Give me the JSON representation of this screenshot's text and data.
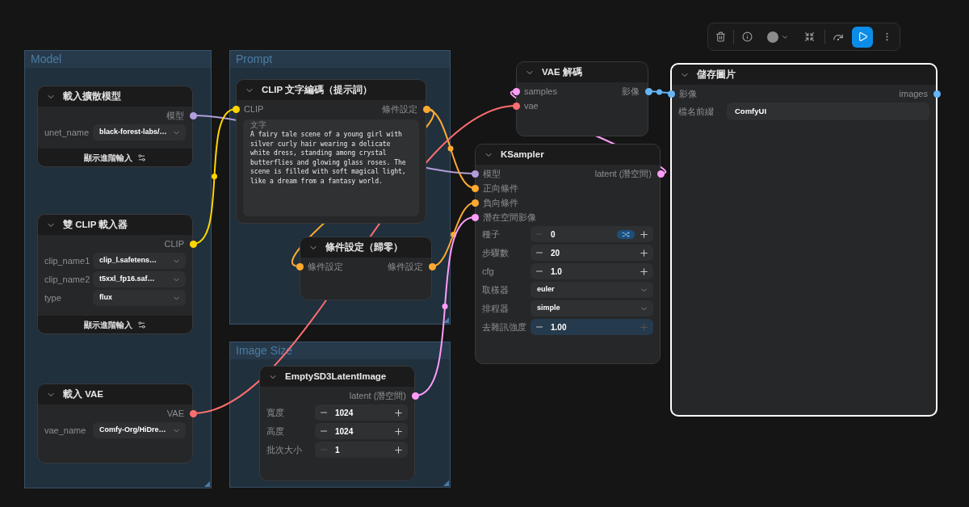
{
  "groups": [
    {
      "title": "Model"
    },
    {
      "title": "Prompt"
    },
    {
      "title": "Image Size"
    }
  ],
  "nodes": [
    {
      "title": "載入擴散模型",
      "selected": false,
      "outputs": [
        {
          "label": "模型",
          "color": "#b39ddb"
        }
      ],
      "widgets": [
        {
          "kind": "combo",
          "label": "unet_name",
          "value": "black-forest-labs/…",
          "hovered": false
        }
      ],
      "advanced_toggle": "顯示進階輸入"
    },
    {
      "title": "雙 CLIP 載入器",
      "selected": false,
      "outputs": [
        {
          "label": "CLIP",
          "color": "#ffd500"
        }
      ],
      "widgets": [
        {
          "kind": "combo",
          "label": "clip_name1",
          "value": "clip_l.safetens…",
          "hovered": false
        },
        {
          "kind": "combo",
          "label": "clip_name2",
          "value": "t5xxl_fp16.saf…",
          "hovered": false
        },
        {
          "kind": "combo",
          "label": "type",
          "value": "flux",
          "hovered": false
        }
      ],
      "advanced_toggle": "顯示進階輸入"
    },
    {
      "title": "載入 VAE",
      "selected": false,
      "outputs": [
        {
          "label": "VAE",
          "color": "#ff6e6e"
        }
      ],
      "widgets": [
        {
          "kind": "combo",
          "label": "vae_name",
          "value": "Comfy-Org/HiDre…",
          "hovered": false
        }
      ]
    },
    {
      "title": "CLIP 文字編碼（提示詞）",
      "selected": false,
      "inputs": [
        {
          "label": "CLIP",
          "color": "#ffd500"
        }
      ],
      "outputs": [
        {
          "label": "條件設定",
          "color": "#ffa931"
        }
      ],
      "widgets": [
        {
          "kind": "textarea",
          "label": "文字",
          "value": "A fairy tale scene of a young girl with silver curly hair wearing a delicate white dress, standing among crystal butterflies and glowing glass roses. The scene is filled with soft magical light, like a dream from a fantasy world.",
          "hovered": false
        }
      ]
    },
    {
      "title": "條件設定（歸零）",
      "selected": false,
      "inputs": [
        {
          "label": "條件設定",
          "color": "#ffa931"
        }
      ],
      "outputs": [
        {
          "label": "條件設定",
          "color": "#ffa931"
        }
      ]
    },
    {
      "title": "EmptySD3LatentImage",
      "selected": false,
      "outputs": [
        {
          "label": "latent (潛空間)",
          "color": "#ff9cf9"
        }
      ],
      "widgets": [
        {
          "kind": "number",
          "label": "寬度",
          "value": "1024",
          "minus_disabled": false,
          "plus_disabled": false,
          "shuffle": false,
          "hovered": false
        },
        {
          "kind": "number",
          "label": "高度",
          "value": "1024",
          "minus_disabled": false,
          "plus_disabled": false,
          "shuffle": false,
          "hovered": false
        },
        {
          "kind": "number",
          "label": "批次大小",
          "value": "1",
          "minus_disabled": true,
          "plus_disabled": false,
          "shuffle": false,
          "hovered": false
        }
      ]
    },
    {
      "title": "VAE 解碼",
      "selected": false,
      "inputs": [
        {
          "label": "samples",
          "color": "#ff9cf9"
        },
        {
          "label": "vae",
          "color": "#ff6e6e"
        }
      ],
      "outputs": [
        {
          "label": "影像",
          "color": "#64b5f6"
        }
      ]
    },
    {
      "title": "KSampler",
      "selected": false,
      "inputs": [
        {
          "label": "模型",
          "color": "#b39ddb"
        },
        {
          "label": "正向條件",
          "color": "#ffa931"
        },
        {
          "label": "負向條件",
          "color": "#ffa931"
        },
        {
          "label": "潛在空間影像",
          "color": "#ff9cf9"
        }
      ],
      "outputs": [
        {
          "label": "latent (潛空間)",
          "color": "#ff9cf9"
        }
      ],
      "widgets": [
        {
          "kind": "number",
          "label": "種子",
          "value": "0",
          "minus_disabled": true,
          "plus_disabled": false,
          "shuffle": true,
          "hovered": false
        },
        {
          "kind": "number",
          "label": "步驟數",
          "value": "20",
          "minus_disabled": false,
          "plus_disabled": false,
          "shuffle": false,
          "hovered": false
        },
        {
          "kind": "number",
          "label": "cfg",
          "value": "1.0",
          "minus_disabled": false,
          "plus_disabled": false,
          "shuffle": false,
          "hovered": false
        },
        {
          "kind": "combo",
          "label": "取樣器",
          "value": "euler",
          "hovered": false
        },
        {
          "kind": "combo",
          "label": "排程器",
          "value": "simple",
          "hovered": false
        },
        {
          "kind": "number",
          "label": "去雜訊強度",
          "value": "1.00",
          "minus_disabled": false,
          "plus_disabled": true,
          "shuffle": false,
          "hovered": true
        }
      ]
    },
    {
      "title": "儲存圖片",
      "selected": true,
      "inputs": [
        {
          "label": "影像",
          "color": "#64b5f6"
        }
      ],
      "outputs": [
        {
          "label": "images",
          "color": "#64b5f6"
        }
      ],
      "widgets": [
        {
          "kind": "text",
          "label": "檔名前綴",
          "value": "ComfyUI",
          "hovered": false
        }
      ]
    }
  ]
}
